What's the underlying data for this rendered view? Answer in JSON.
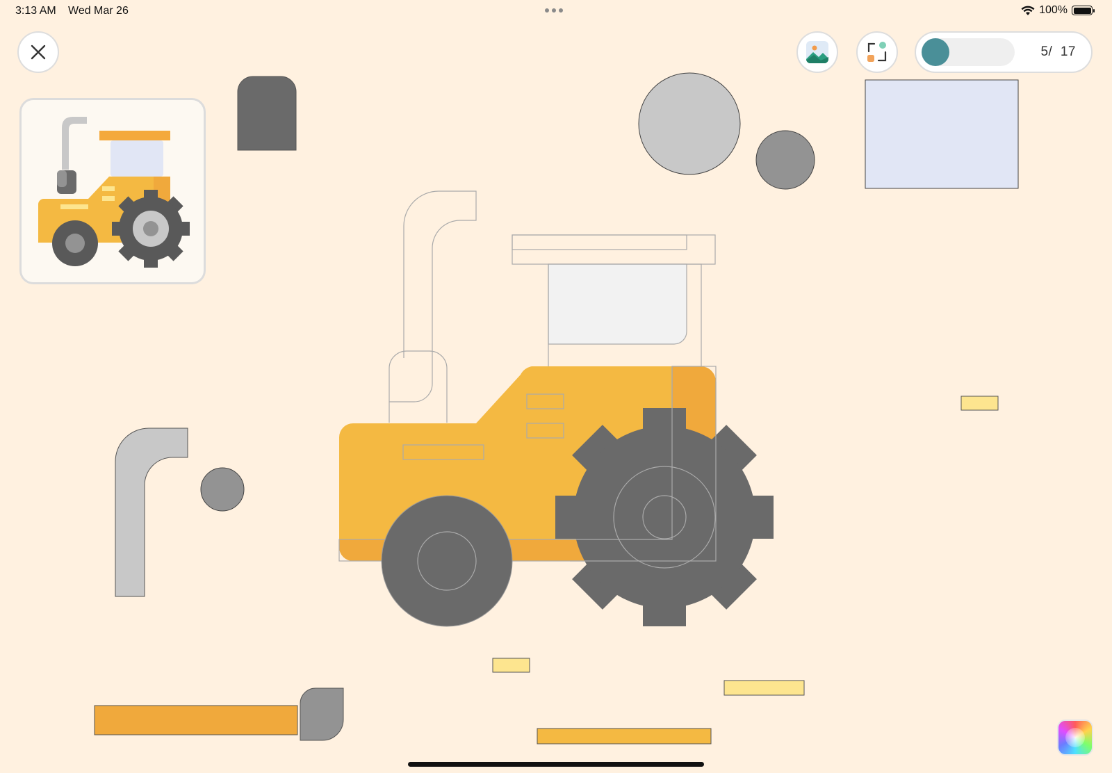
{
  "status_bar": {
    "time": "3:13 AM",
    "date": "Wed Mar 26",
    "battery": "100%"
  },
  "toolbar": {
    "close_icon": "close-icon",
    "image_icon": "image-icon",
    "layout_icon": "layout-icon"
  },
  "progress": {
    "current": "5",
    "total": "17",
    "separator": "/",
    "fraction": 0.294
  },
  "colors": {
    "background": "#fff1e0",
    "tractor_body": "#f4b942",
    "tractor_body_shade": "#f0a93c",
    "tire": "#6a6a6a",
    "hub_light": "#c8c8c8",
    "hub_mid": "#939393",
    "cab_glass": "#e1e6f5",
    "stripe": "#fde58f",
    "roof": "#f4a93c",
    "accent": "#4a8f98"
  }
}
